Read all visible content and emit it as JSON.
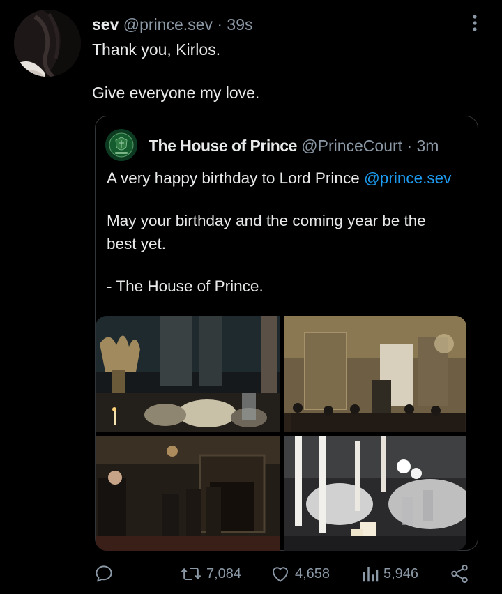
{
  "tweet": {
    "display_name": "sev",
    "handle": "@prince.sev",
    "time": "39s",
    "line1": "Thank you, Kirlos.",
    "line2": "Give everyone my love."
  },
  "quote": {
    "display_name": "The House of Prince",
    "handle": "@PrinceCourt",
    "time": "3m",
    "line1_prefix": "A very happy birthday to Lord Prince ",
    "line1_mention": "@prince.sev",
    "line2": "May your birthday and the coming year be the best yet.",
    "line3": "- The House of Prince."
  },
  "actions": {
    "retweets": "7,084",
    "likes": "4,658",
    "views": "5,946"
  },
  "icons": {
    "reply": "reply-icon",
    "retweet": "retweet-icon",
    "like": "heart-icon",
    "views": "views-icon",
    "share": "share-icon",
    "more": "more-vertical-icon"
  },
  "colors": {
    "background": "#000000",
    "text": "#e7e9ea",
    "muted": "#8b98a5",
    "link": "#1d9bf0",
    "border": "#333639"
  }
}
